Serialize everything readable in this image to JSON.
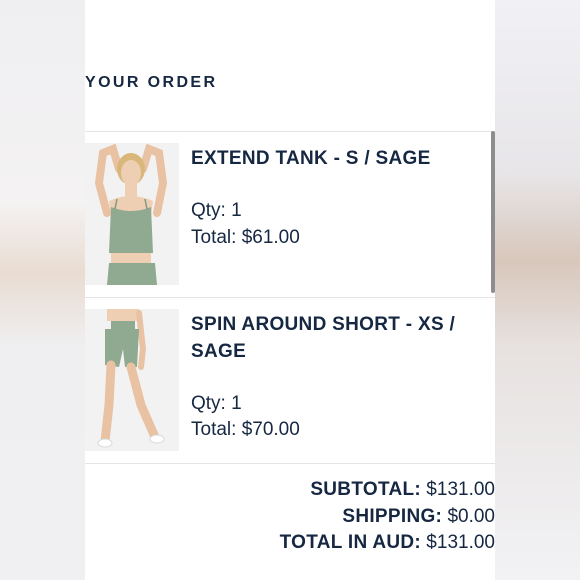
{
  "order": {
    "heading": "YOUR ORDER",
    "items": [
      {
        "name": "EXTEND TANK - S / SAGE",
        "qty": "Qty: 1",
        "total": "Total: $61.00"
      },
      {
        "name": "SPIN AROUND SHORT - XS / SAGE",
        "qty": "Qty: 1",
        "total": "Total: $70.00"
      }
    ],
    "summary": {
      "subtotal_label": "SUBTOTAL:",
      "subtotal_value": " $131.00",
      "shipping_label": "SHIPPING:",
      "shipping_value": " $0.00",
      "total_label": "TOTAL IN AUD:",
      "total_value": " $131.00"
    }
  },
  "colors": {
    "text": "#162742",
    "garment": "#8faa91",
    "background": "#ffffff"
  }
}
